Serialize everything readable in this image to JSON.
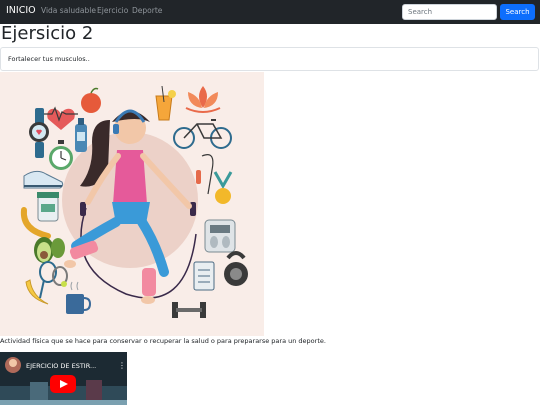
{
  "navbar": {
    "brand": "INICIO",
    "links": [
      "Vida saludable",
      "Ejercicio",
      "Deporte"
    ],
    "search_placeholder": "Search",
    "search_button": "Search"
  },
  "page": {
    "title": "Ejersicio 2",
    "card_text": "Fortalecer tus musculos..",
    "description": "Actividad física que se hace para conservar o recuperar la salud o para prepararse para un deporte."
  },
  "video": {
    "title": "EJERCICIO DE ESTIR...",
    "menu_glyph": "⋮"
  },
  "colors": {
    "navbar_bg": "#212529",
    "primary": "#0d6efd",
    "illustration_bg": "#f9ede8",
    "youtube_red": "#ff0000"
  }
}
